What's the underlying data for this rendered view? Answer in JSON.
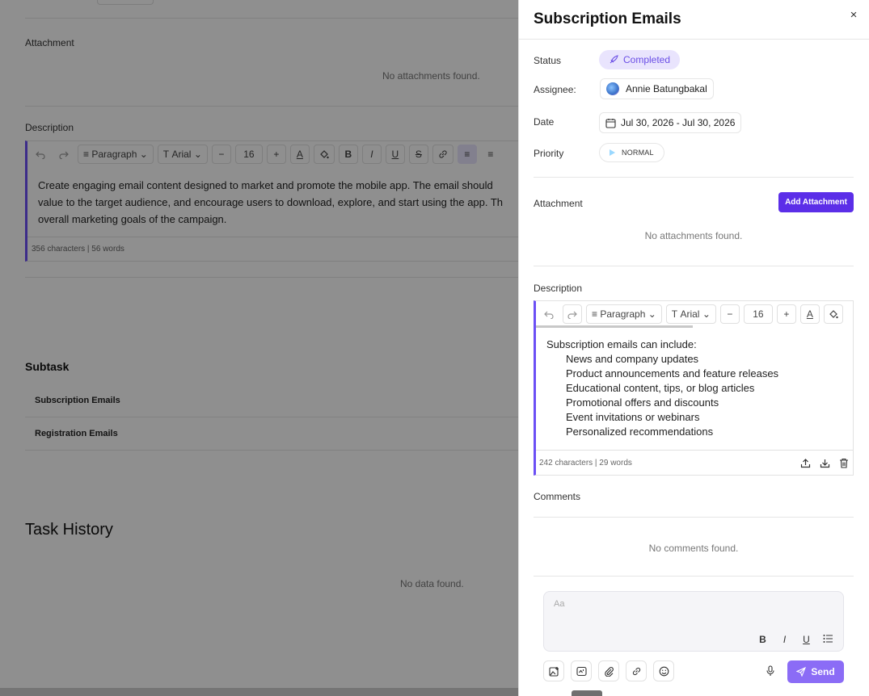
{
  "background": {
    "attachment_label": "Attachment",
    "attachment_empty": "No attachments found.",
    "description_label": "Description",
    "toolbar": {
      "paragraph": "Paragraph",
      "font": "Arial",
      "font_size": "16"
    },
    "description_lines": [
      "Create engaging email content designed to market and promote the mobile app. The email should",
      "value to the target audience, and encourage users to download, explore, and start using the app. Th",
      "overall marketing goals of the campaign."
    ],
    "description_stats": "356 characters  |  56 words",
    "subtask_title": "Subtask",
    "subtasks": [
      "Subscription Emails",
      "Registration Emails"
    ],
    "history_title": "Task History",
    "history_empty": "No data found."
  },
  "panel": {
    "title": "Subscription Emails",
    "close_glyph": "×",
    "status": {
      "label": "Status",
      "value": "Completed"
    },
    "assignee": {
      "label": "Assignee:",
      "value": "Annie Batungbakal"
    },
    "date": {
      "label": "Date",
      "value": "Jul 30, 2026 - Jul 30, 2026"
    },
    "priority": {
      "label": "Priority",
      "value": "NORMAL"
    },
    "attachment": {
      "label": "Attachment",
      "button": "Add Attachment",
      "empty": "No attachments found."
    },
    "description": {
      "label": "Description",
      "toolbar": {
        "paragraph": "Paragraph",
        "font": "Arial",
        "font_size": "16"
      },
      "intro": "Subscription emails can include:",
      "items": [
        "News and company updates",
        "Product announcements and feature releases",
        "Educational content, tips, or blog articles",
        "Promotional offers and discounts",
        "Event invitations or webinars",
        "Personalized recommendations"
      ],
      "stats": "242 characters  |  29 words"
    },
    "comments": {
      "label": "Comments",
      "empty": "No comments found.",
      "placeholder": "Aa",
      "send": "Send"
    }
  },
  "colors": {
    "accent": "#5b2ee8",
    "accent_soft": "#e9e4fd",
    "editor_bar": "#6b4ff5",
    "send": "#8b6cf6"
  }
}
